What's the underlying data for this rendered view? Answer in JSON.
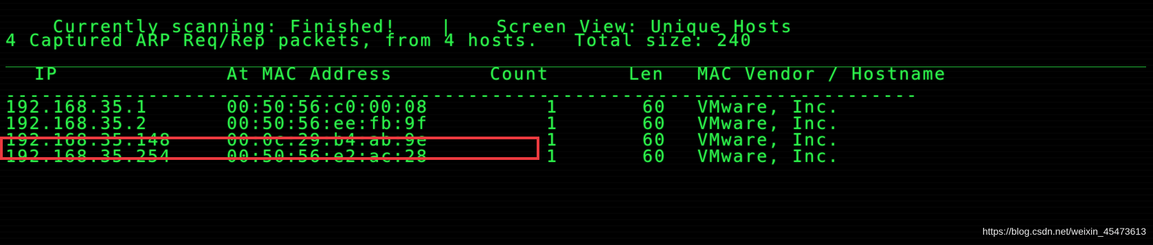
{
  "status": {
    "scanning_label": "Currently scanning: Finished!",
    "separator": "|",
    "screen_view": "Screen View: Unique Hosts"
  },
  "summary": "4 Captured ARP Req/Rep packets, from 4 hosts.   Total size: 240",
  "table": {
    "headers": {
      "ip": "IP",
      "mac": "At MAC Address",
      "count": "Count",
      "len": "Len",
      "vendor": "MAC Vendor / Hostname"
    },
    "divider": "-----------------------------------------------------------------------------",
    "rows": [
      {
        "ip": "192.168.35.1",
        "mac": "00:50:56:c0:00:08",
        "count": "1",
        "len": "60",
        "vendor": "VMware, Inc."
      },
      {
        "ip": "192.168.35.2",
        "mac": "00:50:56:ee:fb:9f",
        "count": "1",
        "len": "60",
        "vendor": "VMware, Inc."
      },
      {
        "ip": "192.168.35.148",
        "mac": "00:0c:29:b4:ab:9e",
        "count": "1",
        "len": "60",
        "vendor": "VMware, Inc."
      },
      {
        "ip": "192.168.35.254",
        "mac": "00:50:56:e2:ac:28",
        "count": "1",
        "len": "60",
        "vendor": "VMware, Inc."
      }
    ]
  },
  "highlight": {
    "row": "192.168.35.148",
    "color": "#ec3a3f"
  },
  "colors": {
    "text": "#2cf24a",
    "background": "#000000"
  },
  "watermark": "https://blog.csdn.net/weixin_45473613"
}
